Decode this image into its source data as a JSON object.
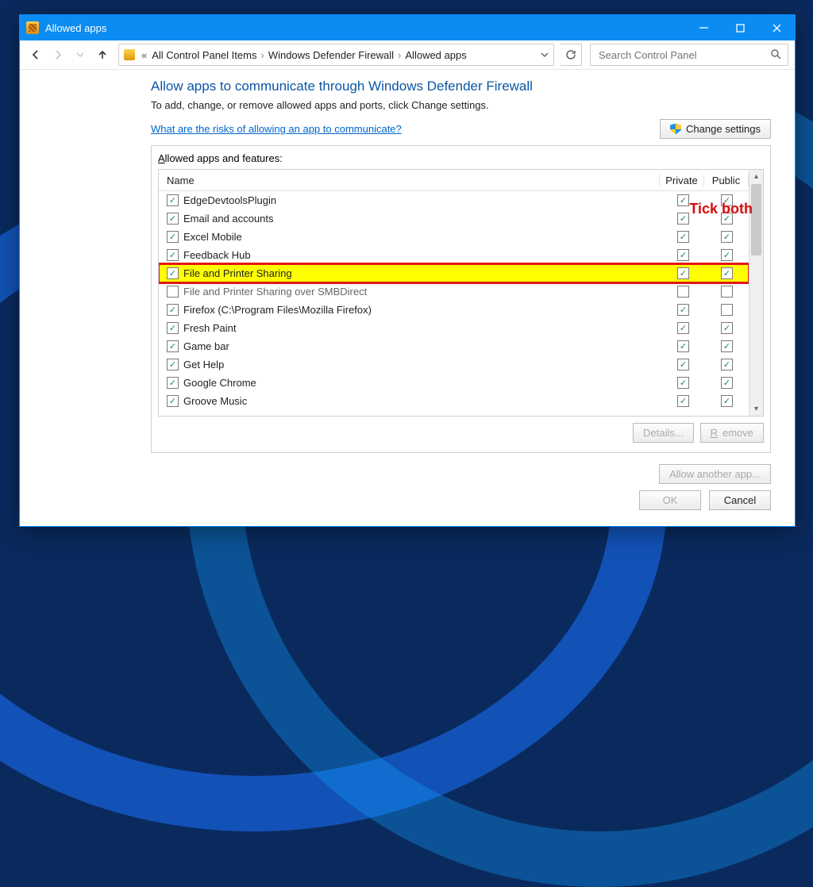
{
  "titlebar": {
    "title": "Allowed apps"
  },
  "breadcrumb": {
    "items": [
      "All Control Panel Items",
      "Windows Defender Firewall",
      "Allowed apps"
    ]
  },
  "search": {
    "placeholder": "Search Control Panel"
  },
  "page": {
    "heading": "Allow apps to communicate through Windows Defender Firewall",
    "sub": "To add, change, or remove allowed apps and ports, click Change settings.",
    "riskLink": "What are the risks of allowing an app to communicate?",
    "changeSettings": "Change settings",
    "panelLabel": "Allowed apps and features:",
    "cols": {
      "name": "Name",
      "private": "Private",
      "public": "Public"
    },
    "details": "Details...",
    "remove": "Remove",
    "allowAnother": "Allow another app...",
    "ok": "OK",
    "cancel": "Cancel"
  },
  "annotation": "Tick both",
  "rows": [
    {
      "name": "EdgeDevtoolsPlugin",
      "app": true,
      "priv": true,
      "pub": true
    },
    {
      "name": "Email and accounts",
      "app": true,
      "priv": true,
      "pub": true
    },
    {
      "name": "Excel Mobile",
      "app": true,
      "priv": true,
      "pub": true
    },
    {
      "name": "Feedback Hub",
      "app": true,
      "priv": true,
      "pub": true
    },
    {
      "name": "File and Printer Sharing",
      "app": true,
      "priv": true,
      "pub": true,
      "highlight": true
    },
    {
      "name": "File and Printer Sharing over SMBDirect",
      "app": false,
      "priv": false,
      "pub": false
    },
    {
      "name": "Firefox (C:\\Program Files\\Mozilla Firefox)",
      "app": true,
      "priv": true,
      "pub": false
    },
    {
      "name": "Fresh Paint",
      "app": true,
      "priv": true,
      "pub": true
    },
    {
      "name": "Game bar",
      "app": true,
      "priv": true,
      "pub": true
    },
    {
      "name": "Get Help",
      "app": true,
      "priv": true,
      "pub": true
    },
    {
      "name": "Google Chrome",
      "app": true,
      "priv": true,
      "pub": true
    },
    {
      "name": "Groove Music",
      "app": true,
      "priv": true,
      "pub": true
    }
  ]
}
